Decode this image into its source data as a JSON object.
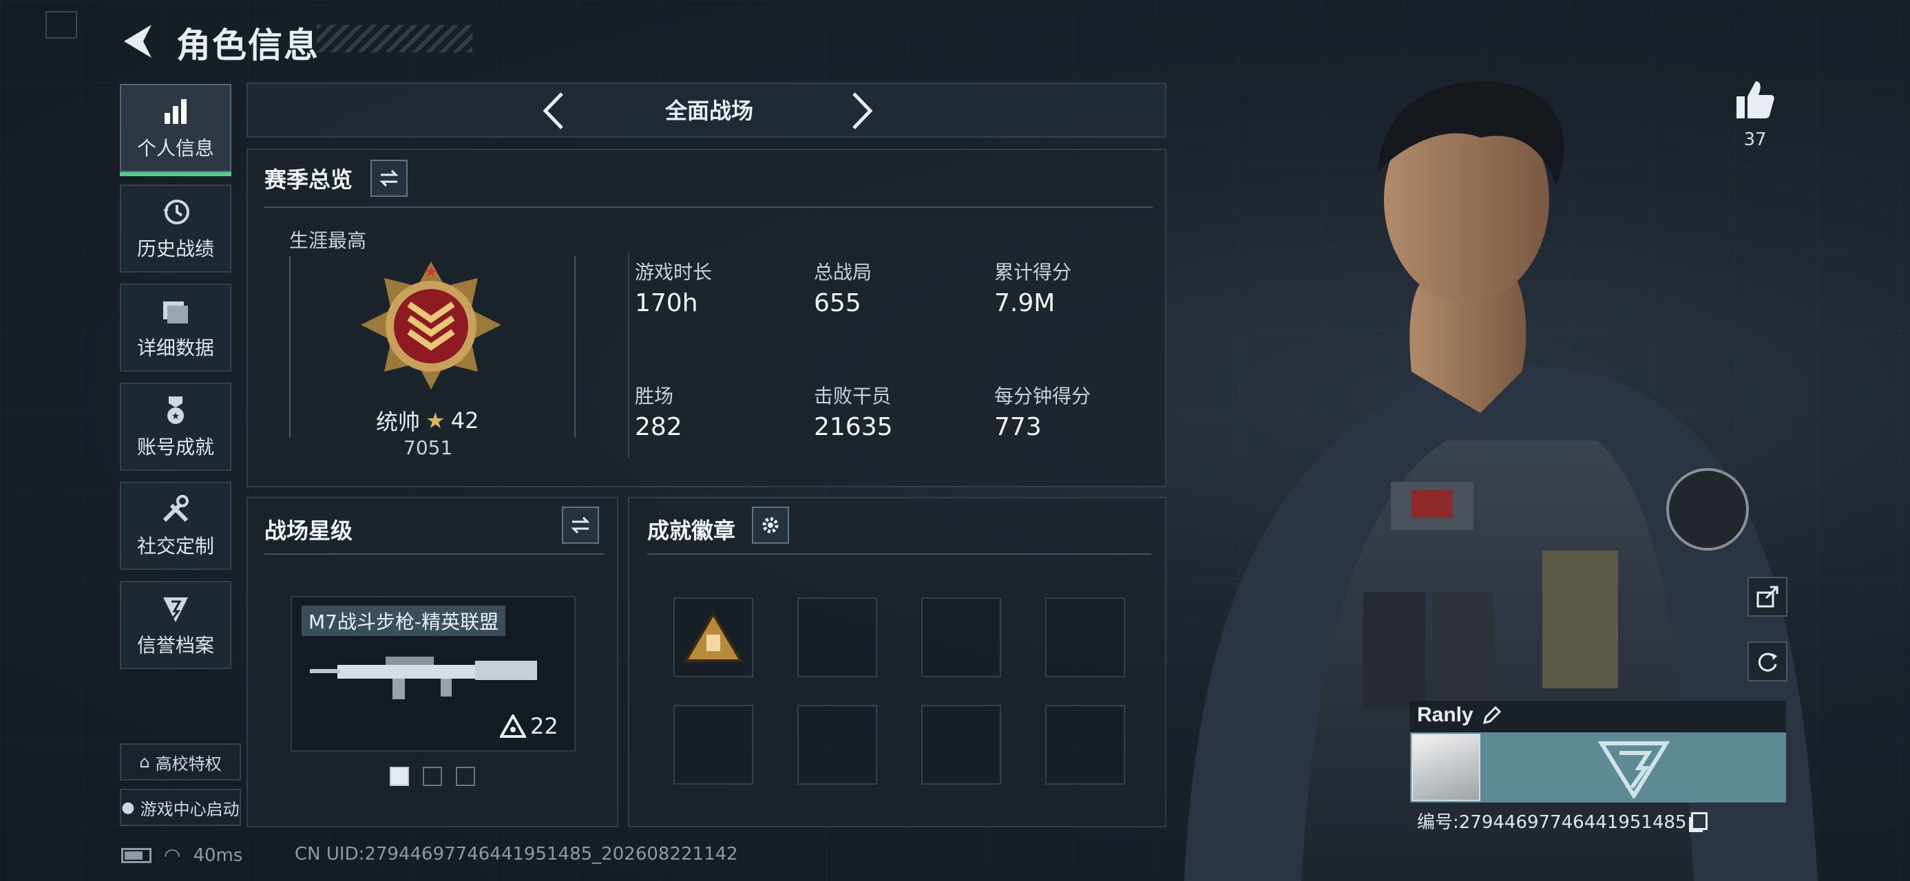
{
  "header": {
    "title": "角色信息"
  },
  "sidebar": {
    "items": [
      {
        "label": "个人信息",
        "icon": "bar-chart-icon",
        "active": true
      },
      {
        "label": "历史战绩",
        "icon": "history-clock-icon"
      },
      {
        "label": "详细数据",
        "icon": "folder-icon"
      },
      {
        "label": "账号成就",
        "icon": "achievement-medal-icon"
      },
      {
        "label": "社交定制",
        "icon": "tools-icon"
      },
      {
        "label": "信誉档案",
        "icon": "credit-emblem-icon"
      }
    ],
    "bottom": [
      {
        "label": "高校特权",
        "icon": "campus-icon"
      },
      {
        "label": "游戏中心启动",
        "icon": "game-center-icon"
      }
    ]
  },
  "mode": {
    "label": "全面战场"
  },
  "season_overview": {
    "title": "赛季总览",
    "career_label": "生涯最高",
    "rank_name": "统帅",
    "rank_level": "42",
    "rank_points": "7051",
    "stats": [
      {
        "label": "游戏时长",
        "value": "170h"
      },
      {
        "label": "总战局",
        "value": "655"
      },
      {
        "label": "累计得分",
        "value": "7.9M"
      },
      {
        "label": "胜场",
        "value": "282"
      },
      {
        "label": "击败干员",
        "value": "21635"
      },
      {
        "label": "每分钟得分",
        "value": "773"
      }
    ]
  },
  "star_level": {
    "title": "战场星级",
    "weapon_name": "M7战斗步枪-精英联盟",
    "weapon_level": "22",
    "page_count": 3,
    "page_active": 1
  },
  "achievements": {
    "title": "成就徽章",
    "slots": 8,
    "filled": 1
  },
  "player": {
    "likes": "37",
    "name": "Ranly",
    "id_text": "编号:27944697746441951485"
  },
  "status": {
    "ping": "40ms",
    "uid": "CN UID:27944697746441951485_202608221142"
  },
  "colors": {
    "accent": "#4fd18b",
    "banner": "#5e8a96"
  }
}
